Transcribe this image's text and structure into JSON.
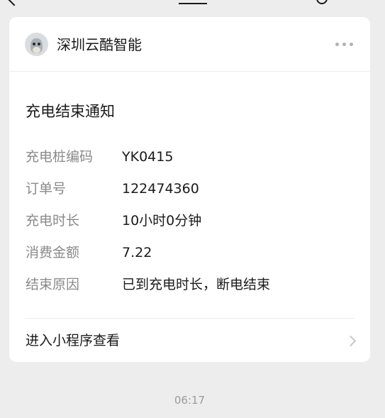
{
  "account": {
    "name": "深圳云酷智能"
  },
  "notice": {
    "title": "充电结束通知",
    "fields": [
      {
        "label": "充电桩编码",
        "value": "YK0415"
      },
      {
        "label": "订单号",
        "value": "122474360"
      },
      {
        "label": "充电时长",
        "value": "10小时0分钟"
      },
      {
        "label": "消费金额",
        "value": "7.22"
      },
      {
        "label": "结束原因",
        "value": "已到充电时长，断电结束"
      }
    ]
  },
  "footer": {
    "link_label": "进入小程序查看"
  },
  "message": {
    "time": "06:17"
  },
  "icons": {
    "top_back": "back-arrow-icon",
    "top_search": "search-icon",
    "top_menu": "menu-icon",
    "more": "more-dots-icon",
    "chevron": "chevron-right-icon"
  }
}
